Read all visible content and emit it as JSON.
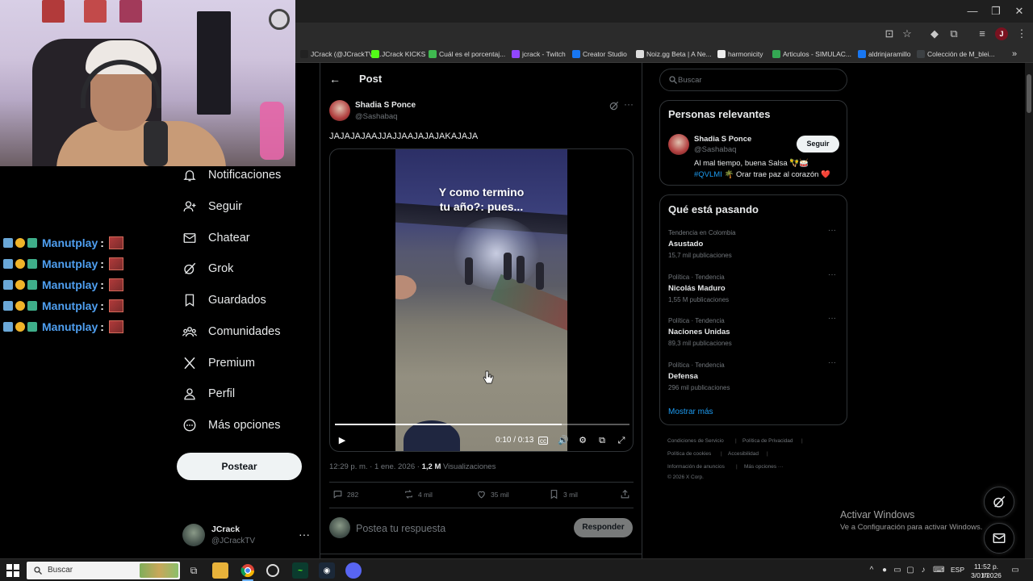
{
  "browser": {
    "bookmarks": [
      {
        "label": "JCrack (@JCrackTV)...",
        "color": "#222222"
      },
      {
        "label": "JCrack KICKS",
        "color": "#53fc18"
      },
      {
        "label": "Cuál es el porcentaj...",
        "color": "#3fb950"
      },
      {
        "label": "jcrack - Twitch",
        "color": "#9146ff"
      },
      {
        "label": "Creator Studio",
        "color": "#1877f2"
      },
      {
        "label": "Noiz.gg Beta | A Ne...",
        "color": "#dddddd"
      },
      {
        "label": "harmonicity",
        "color": "#eeeeee"
      },
      {
        "label": "Articulos - SIMULAC...",
        "color": "#34a853"
      },
      {
        "label": "aldrinjaramillo",
        "color": "#1877f2"
      },
      {
        "label": "Colección de M_blei...",
        "color": "#3c4043"
      }
    ]
  },
  "chat": {
    "lines": [
      {
        "user": "Manutplay",
        "sep": ":"
      },
      {
        "user": "Manutplay",
        "sep": ":"
      },
      {
        "user": "Manutplay",
        "sep": ":"
      },
      {
        "user": "Manutplay",
        "sep": ":"
      },
      {
        "user": "Manutplay",
        "sep": ":"
      }
    ]
  },
  "nav": {
    "items": [
      {
        "label": "Notificaciones",
        "icon": "bell-icon"
      },
      {
        "label": "Seguir",
        "icon": "follow-icon"
      },
      {
        "label": "Chatear",
        "icon": "mail-icon"
      },
      {
        "label": "Grok",
        "icon": "grok-icon"
      },
      {
        "label": "Guardados",
        "icon": "bookmark-icon"
      },
      {
        "label": "Comunidades",
        "icon": "communities-icon"
      },
      {
        "label": "Premium",
        "icon": "x-logo-icon"
      },
      {
        "label": "Perfil",
        "icon": "person-icon"
      },
      {
        "label": "Más opciones",
        "icon": "more-circle-icon"
      }
    ],
    "post_button": "Postear",
    "account": {
      "name": "JCrack",
      "handle": "@JCrackTV",
      "more": "···"
    }
  },
  "post": {
    "header_title": "Post",
    "author_name": "Shadia S Ponce",
    "author_handle": "@Sashabaq",
    "more": "···",
    "text": "JAJAJAJAAJJAJJAAJAJAJAKAJAJA",
    "video": {
      "caption": "Y como termino\ntu año?: pues...",
      "time": "0:10 / 0:13",
      "progress": 0.77
    },
    "meta_time": "12:29 p. m. · 1 ene. 2026 · ",
    "views_count": "1,2 M",
    "views_label": " Visualizaciones",
    "stats": {
      "replies": "282",
      "reposts": "4 mil",
      "likes": "35 mil",
      "bookmarks": "3 mil"
    },
    "reply_placeholder": "Postea tu respuesta",
    "reply_button": "Responder"
  },
  "sidebar": {
    "search_placeholder": "Buscar",
    "people": {
      "title": "Personas relevantes",
      "name": "Shadia S Ponce",
      "handle": "@Sashabaq",
      "follow": "Seguir",
      "bio_1": "Al mal tiempo, buena Salsa 🪇🥁",
      "bio_hashtag": "#QVLMI",
      "bio_2_rest": " 🌴 Orar trae paz al corazón ❤️"
    },
    "trends": {
      "title": "Qué está pasando",
      "items": [
        {
          "meta": "Tendencia en Colombia",
          "name": "Asustado",
          "count": "15,7 mil publicaciones"
        },
        {
          "meta": "Política · Tendencia",
          "name": "Nicolás Maduro",
          "count": "1,55 M publicaciones"
        },
        {
          "meta": "Política · Tendencia",
          "name": "Naciones Unidas",
          "count": "89,3 mil publicaciones"
        },
        {
          "meta": "Política · Tendencia",
          "name": "Defensa",
          "count": "296 mil publicaciones"
        }
      ],
      "show_more": "Mostrar más"
    },
    "footer": {
      "terms": "Condiciones de Servicio",
      "privacy": "Política de Privacidad",
      "cookies": "Política de cookies",
      "accessibility": "Accesibilidad",
      "ads": "Información de anuncios",
      "more": "Más opciones ···",
      "copyright": "© 2026 X Corp."
    }
  },
  "windows": {
    "activate_title": "Activar Windows",
    "activate_sub": "Ve a Configuración para activar Windows.",
    "search_label": "Buscar",
    "lang": "ESP",
    "time": "11:52 p. m.",
    "date": "3/01/2026"
  },
  "colors": {
    "accent": "#1d9bf0",
    "chat_user": "#4f9ff0",
    "background": "#000000"
  }
}
